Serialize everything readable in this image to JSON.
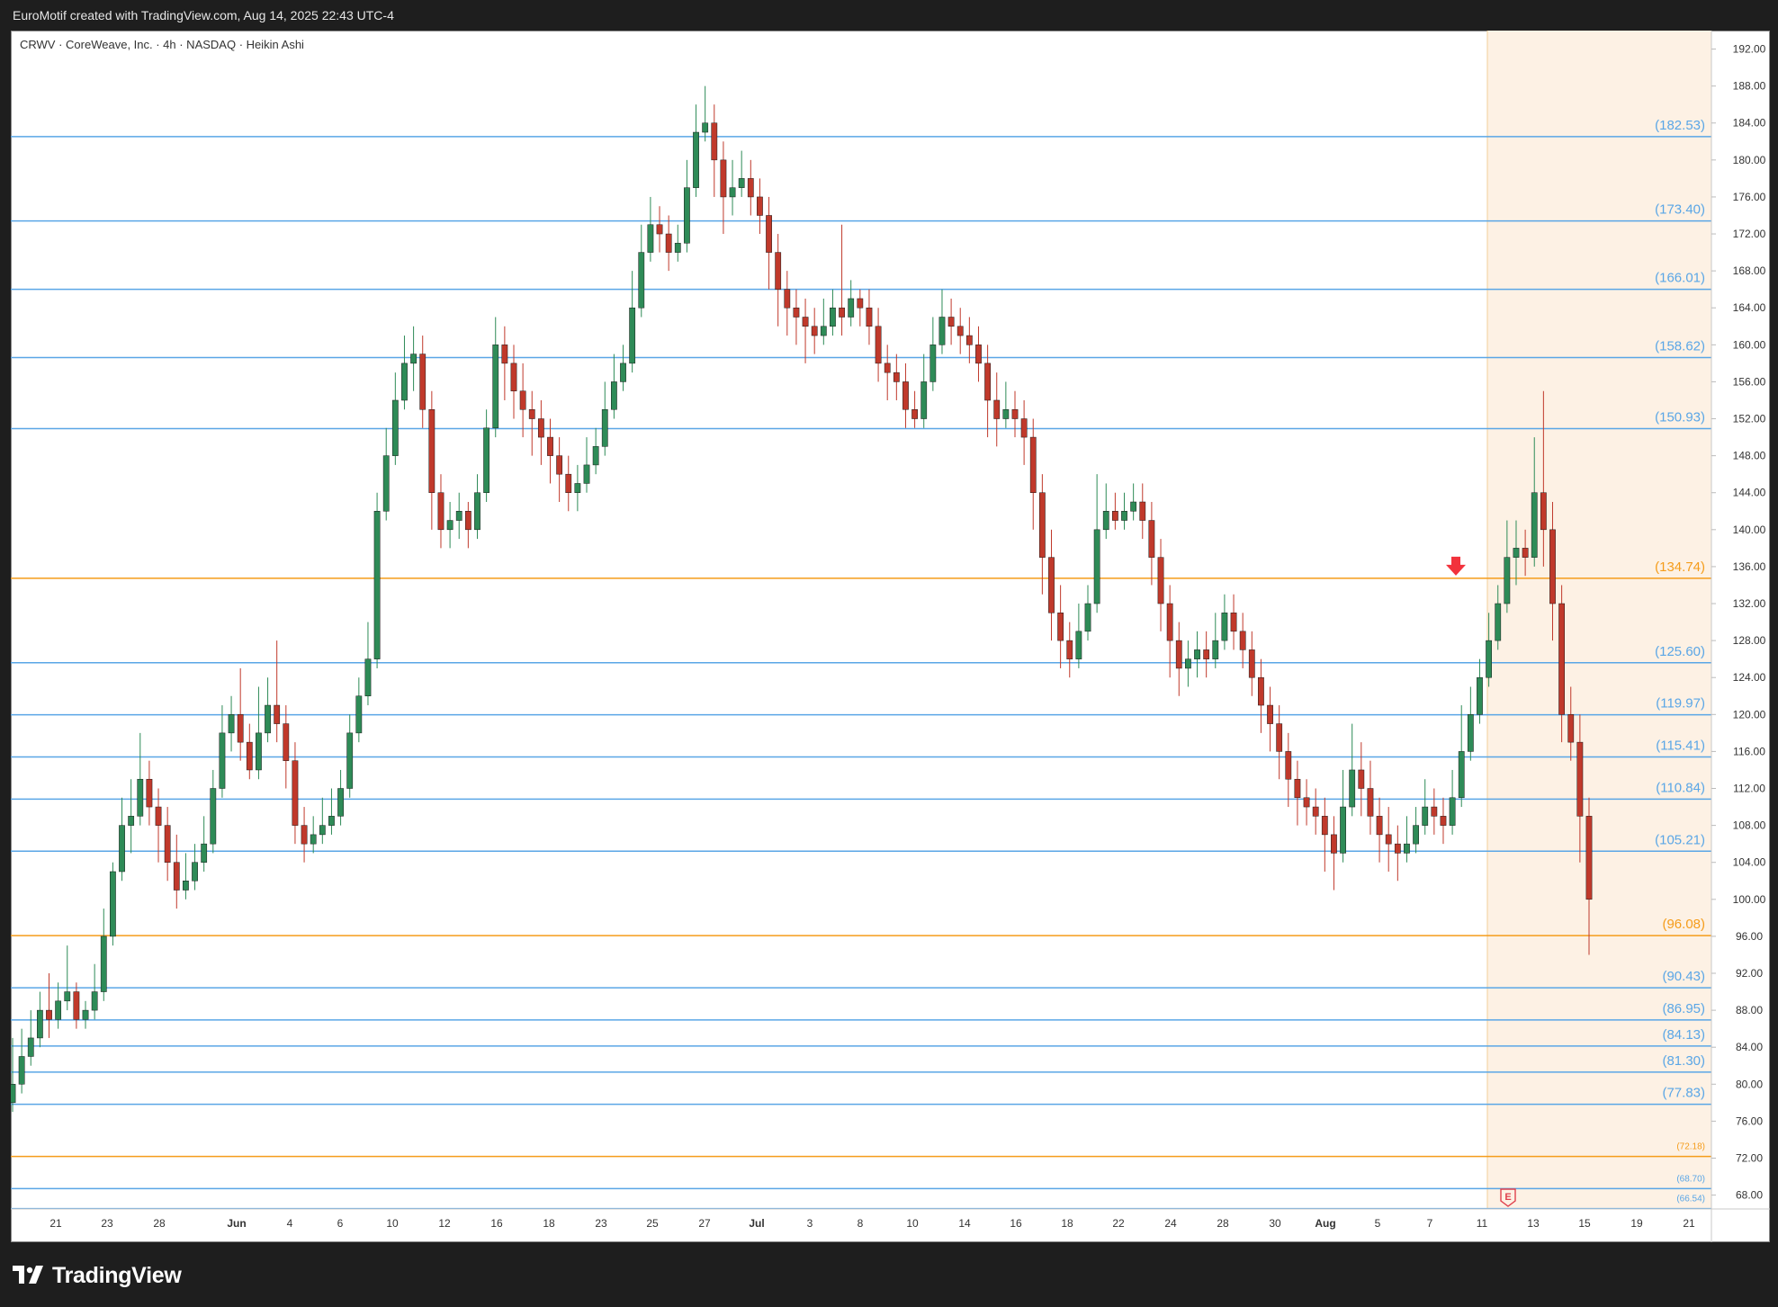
{
  "header": {
    "attribution": "EuroMotif created with TradingView.com, Aug 14, 2025 22:43 UTC-4"
  },
  "footer": {
    "brand": "TradingView"
  },
  "chart_data": {
    "type": "candlestick",
    "title": "CRWV · CoreWeave, Inc. · 4h · NASDAQ · Heikin Ashi",
    "ylim": [
      66.5,
      194
    ],
    "y_ticks": [
      "68.00",
      "72.00",
      "76.00",
      "80.00",
      "84.00",
      "88.00",
      "92.00",
      "96.00",
      "100.00",
      "104.00",
      "108.00",
      "112.00",
      "116.00",
      "120.00",
      "124.00",
      "128.00",
      "132.00",
      "136.00",
      "140.00",
      "144.00",
      "148.00",
      "152.00",
      "156.00",
      "160.00",
      "164.00",
      "168.00",
      "172.00",
      "176.00",
      "180.00",
      "184.00",
      "188.00",
      "192.00"
    ],
    "x_ticks": [
      "21",
      "23",
      "28",
      "Jun",
      "4",
      "6",
      "10",
      "12",
      "16",
      "18",
      "23",
      "25",
      "27",
      "Jul",
      "3",
      "8",
      "10",
      "14",
      "16",
      "18",
      "22",
      "24",
      "28",
      "30",
      "Aug",
      "5",
      "7",
      "11",
      "13",
      "15",
      "19",
      "21"
    ],
    "levels": [
      {
        "value": 182.53,
        "label": "(182.53)",
        "color": "#5aa6e6"
      },
      {
        "value": 173.4,
        "label": "(173.40)",
        "color": "#5aa6e6"
      },
      {
        "value": 166.01,
        "label": "(166.01)",
        "color": "#5aa6e6"
      },
      {
        "value": 158.62,
        "label": "(158.62)",
        "color": "#5aa6e6"
      },
      {
        "value": 150.93,
        "label": "(150.93)",
        "color": "#5aa6e6"
      },
      {
        "value": 134.74,
        "label": "(134.74)",
        "color": "#f59c1a"
      },
      {
        "value": 125.6,
        "label": "(125.60)",
        "color": "#5aa6e6"
      },
      {
        "value": 119.97,
        "label": "(119.97)",
        "color": "#5aa6e6"
      },
      {
        "value": 115.41,
        "label": "(115.41)",
        "color": "#5aa6e6"
      },
      {
        "value": 110.84,
        "label": "(110.84)",
        "color": "#5aa6e6"
      },
      {
        "value": 105.21,
        "label": "(105.21)",
        "color": "#5aa6e6"
      },
      {
        "value": 96.08,
        "label": "(96.08)",
        "color": "#f59c1a"
      },
      {
        "value": 90.43,
        "label": "(90.43)",
        "color": "#5aa6e6"
      },
      {
        "value": 86.95,
        "label": "(86.95)",
        "color": "#5aa6e6"
      },
      {
        "value": 84.13,
        "label": "(84.13)",
        "color": "#5aa6e6"
      },
      {
        "value": 81.3,
        "label": "(81.30)",
        "color": "#5aa6e6"
      },
      {
        "value": 77.83,
        "label": "(77.83)",
        "color": "#5aa6e6"
      },
      {
        "value": 72.18,
        "label": "(72.18)",
        "color": "#f59c1a"
      },
      {
        "value": 68.7,
        "label": "(68.70)",
        "color": "#5aa6e6"
      },
      {
        "value": 66.54,
        "label": "(66.54)",
        "color": "#5aa6e6"
      }
    ],
    "colors": {
      "up": "#2e8b57",
      "down": "#c0392b",
      "level_blue": "#5aa6e6",
      "level_orange": "#f59c1a",
      "highlight_zone": "#fdf1e4",
      "arrow": "#f2323c"
    },
    "earnings_marker": "E",
    "candles": [
      [
        78,
        80,
        77,
        85
      ],
      [
        80,
        83,
        79,
        86
      ],
      [
        83,
        85,
        82,
        88
      ],
      [
        85,
        88,
        84,
        90
      ],
      [
        88,
        87,
        85,
        92
      ],
      [
        87,
        89,
        86,
        91
      ],
      [
        89,
        90,
        88,
        95
      ],
      [
        90,
        87,
        86,
        91
      ],
      [
        87,
        88,
        86,
        89
      ],
      [
        88,
        90,
        87,
        93
      ],
      [
        90,
        96,
        89,
        99
      ],
      [
        96,
        103,
        95,
        104
      ],
      [
        103,
        108,
        102,
        111
      ],
      [
        108,
        109,
        105,
        113
      ],
      [
        109,
        113,
        108,
        118
      ],
      [
        113,
        110,
        108,
        115
      ],
      [
        110,
        108,
        104,
        112
      ],
      [
        108,
        104,
        102,
        110
      ],
      [
        104,
        101,
        99,
        107
      ],
      [
        101,
        102,
        100,
        105
      ],
      [
        102,
        104,
        101,
        106
      ],
      [
        104,
        106,
        103,
        109
      ],
      [
        106,
        112,
        105,
        114
      ],
      [
        112,
        118,
        111,
        121
      ],
      [
        118,
        120,
        116,
        122
      ],
      [
        120,
        117,
        115,
        125
      ],
      [
        117,
        114,
        113,
        119
      ],
      [
        114,
        118,
        113,
        123
      ],
      [
        118,
        121,
        117,
        124
      ],
      [
        121,
        119,
        117,
        128
      ],
      [
        119,
        115,
        112,
        121
      ],
      [
        115,
        108,
        106,
        117
      ],
      [
        108,
        106,
        104,
        110
      ],
      [
        106,
        107,
        105,
        109
      ],
      [
        107,
        108,
        106,
        111
      ],
      [
        108,
        109,
        107,
        112
      ],
      [
        109,
        112,
        108,
        114
      ],
      [
        112,
        118,
        111,
        120
      ],
      [
        118,
        122,
        117,
        124
      ],
      [
        122,
        126,
        121,
        130
      ],
      [
        126,
        142,
        125,
        144
      ],
      [
        142,
        148,
        141,
        151
      ],
      [
        148,
        154,
        147,
        157
      ],
      [
        154,
        158,
        153,
        161
      ],
      [
        158,
        159,
        155,
        162
      ],
      [
        159,
        153,
        151,
        161
      ],
      [
        153,
        144,
        140,
        155
      ],
      [
        144,
        140,
        138,
        146
      ],
      [
        140,
        141,
        138,
        143
      ],
      [
        141,
        142,
        139,
        144
      ],
      [
        142,
        140,
        138,
        143
      ],
      [
        140,
        144,
        139,
        146
      ],
      [
        144,
        151,
        143,
        153
      ],
      [
        151,
        160,
        150,
        163
      ],
      [
        160,
        158,
        154,
        162
      ],
      [
        158,
        155,
        152,
        160
      ],
      [
        155,
        153,
        150,
        158
      ],
      [
        153,
        152,
        148,
        155
      ],
      [
        152,
        150,
        147,
        154
      ],
      [
        150,
        148,
        145,
        152
      ],
      [
        148,
        146,
        143,
        150
      ],
      [
        146,
        144,
        142,
        148
      ],
      [
        144,
        145,
        142,
        147
      ],
      [
        145,
        147,
        144,
        150
      ],
      [
        147,
        149,
        146,
        151
      ],
      [
        149,
        153,
        148,
        156
      ],
      [
        153,
        156,
        152,
        159
      ],
      [
        156,
        158,
        155,
        160
      ],
      [
        158,
        164,
        157,
        168
      ],
      [
        164,
        170,
        163,
        173
      ],
      [
        170,
        173,
        169,
        176
      ],
      [
        173,
        172,
        170,
        175
      ],
      [
        172,
        170,
        168,
        174
      ],
      [
        170,
        171,
        169,
        173
      ],
      [
        171,
        177,
        170,
        180
      ],
      [
        177,
        183,
        176,
        186
      ],
      [
        183,
        184,
        182,
        188
      ],
      [
        184,
        180,
        176,
        186
      ],
      [
        180,
        176,
        172,
        182
      ],
      [
        176,
        177,
        174,
        180
      ],
      [
        177,
        178,
        176,
        181
      ],
      [
        178,
        176,
        174,
        180
      ],
      [
        176,
        174,
        172,
        178
      ],
      [
        174,
        170,
        166,
        176
      ],
      [
        170,
        166,
        162,
        172
      ],
      [
        166,
        164,
        161,
        168
      ],
      [
        164,
        163,
        160,
        166
      ],
      [
        163,
        162,
        158,
        165
      ],
      [
        162,
        161,
        159,
        164
      ],
      [
        161,
        162,
        160,
        165
      ],
      [
        162,
        164,
        161,
        166
      ],
      [
        164,
        163,
        161,
        173
      ],
      [
        163,
        165,
        162,
        167
      ],
      [
        165,
        164,
        162,
        166
      ],
      [
        164,
        162,
        160,
        166
      ],
      [
        162,
        158,
        156,
        164
      ],
      [
        158,
        157,
        154,
        160
      ],
      [
        157,
        156,
        154,
        159
      ],
      [
        156,
        153,
        151,
        158
      ],
      [
        153,
        152,
        151,
        155
      ],
      [
        152,
        156,
        151,
        159
      ],
      [
        156,
        160,
        155,
        163
      ],
      [
        160,
        163,
        159,
        166
      ],
      [
        163,
        162,
        160,
        165
      ],
      [
        162,
        161,
        159,
        164
      ],
      [
        161,
        160,
        158,
        163
      ],
      [
        160,
        158,
        156,
        162
      ],
      [
        158,
        154,
        150,
        160
      ],
      [
        154,
        152,
        149,
        157
      ],
      [
        152,
        153,
        151,
        156
      ],
      [
        153,
        152,
        150,
        155
      ],
      [
        152,
        150,
        147,
        154
      ],
      [
        150,
        144,
        140,
        152
      ],
      [
        144,
        137,
        133,
        146
      ],
      [
        137,
        131,
        128,
        140
      ],
      [
        131,
        128,
        125,
        134
      ],
      [
        128,
        126,
        124,
        130
      ],
      [
        126,
        129,
        125,
        132
      ],
      [
        129,
        132,
        128,
        134
      ],
      [
        132,
        140,
        131,
        146
      ],
      [
        140,
        142,
        139,
        145
      ],
      [
        142,
        141,
        140,
        144
      ],
      [
        141,
        142,
        140,
        144
      ],
      [
        142,
        143,
        141,
        145
      ],
      [
        143,
        141,
        139,
        145
      ],
      [
        141,
        137,
        134,
        143
      ],
      [
        137,
        132,
        129,
        139
      ],
      [
        132,
        128,
        124,
        134
      ],
      [
        128,
        125,
        122,
        130
      ],
      [
        125,
        126,
        123,
        128
      ],
      [
        126,
        127,
        124,
        129
      ],
      [
        127,
        126,
        124,
        129
      ],
      [
        126,
        128,
        125,
        131
      ],
      [
        128,
        131,
        127,
        133
      ],
      [
        131,
        129,
        127,
        133
      ],
      [
        129,
        127,
        125,
        131
      ],
      [
        127,
        124,
        122,
        129
      ],
      [
        124,
        121,
        118,
        126
      ],
      [
        121,
        119,
        116,
        123
      ],
      [
        119,
        116,
        113,
        121
      ],
      [
        116,
        113,
        110,
        118
      ],
      [
        113,
        111,
        108,
        115
      ],
      [
        111,
        110,
        108,
        113
      ],
      [
        110,
        109,
        107,
        112
      ],
      [
        109,
        107,
        103,
        111
      ],
      [
        107,
        105,
        101,
        109
      ],
      [
        105,
        110,
        104,
        114
      ],
      [
        110,
        114,
        109,
        119
      ],
      [
        114,
        112,
        109,
        117
      ],
      [
        112,
        109,
        107,
        115
      ],
      [
        109,
        107,
        104,
        111
      ],
      [
        107,
        106,
        103,
        110
      ],
      [
        106,
        105,
        102,
        108
      ],
      [
        105,
        106,
        104,
        109
      ],
      [
        106,
        108,
        105,
        110
      ],
      [
        108,
        110,
        107,
        113
      ],
      [
        110,
        109,
        107,
        112
      ],
      [
        109,
        108,
        106,
        111
      ],
      [
        108,
        111,
        107,
        114
      ],
      [
        111,
        116,
        110,
        121
      ],
      [
        116,
        120,
        115,
        123
      ],
      [
        120,
        124,
        119,
        126
      ],
      [
        124,
        128,
        123,
        131
      ],
      [
        128,
        132,
        127,
        134
      ],
      [
        132,
        137,
        131,
        141
      ],
      [
        137,
        138,
        134,
        141
      ],
      [
        138,
        137,
        135,
        140
      ],
      [
        137,
        144,
        136,
        150
      ],
      [
        144,
        140,
        136,
        155
      ],
      [
        140,
        132,
        128,
        143
      ],
      [
        132,
        120,
        117,
        134
      ],
      [
        120,
        117,
        115,
        123
      ],
      [
        117,
        109,
        104,
        120
      ],
      [
        109,
        100,
        94,
        111
      ]
    ]
  }
}
